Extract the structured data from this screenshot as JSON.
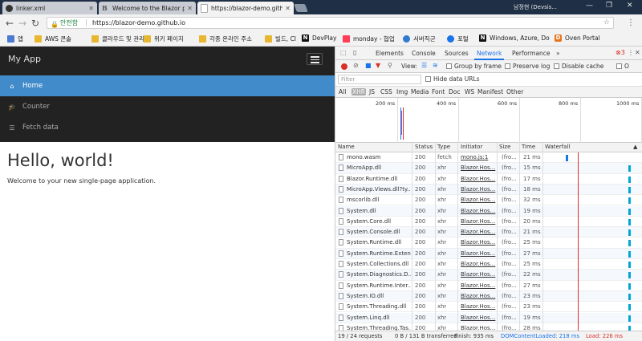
{
  "browser": {
    "tabs": [
      {
        "title": "linker.xml",
        "icon": "github-icon"
      },
      {
        "title": "Welcome to the Blazor p",
        "icon": "blazor-icon"
      },
      {
        "title": "https://blazor-demo.githu",
        "icon": "page-icon"
      }
    ],
    "user": "남정현 (Devsis...",
    "security_label": "안전함",
    "url": "https://blazor-demo.github.io",
    "bookmarks": [
      {
        "label": "앱",
        "icon": "apps-icon"
      },
      {
        "label": "AWS 콘솔",
        "icon": "folder-icon"
      },
      {
        "label": "클라우드 및 관리",
        "icon": "folder-icon"
      },
      {
        "label": "위키 페이지",
        "icon": "folder-icon"
      },
      {
        "label": "각종 온라인 주소",
        "icon": "folder-icon"
      },
      {
        "label": "빌드, CI",
        "icon": "folder-icon"
      },
      {
        "label": "DevPlay",
        "icon": "notion-icon"
      },
      {
        "label": "monday - 협업",
        "icon": "monday-icon"
      },
      {
        "label": "서버직군",
        "icon": "globe-icon"
      },
      {
        "label": "포털",
        "icon": "edge-icon"
      },
      {
        "label": "Windows, Azure, Do",
        "icon": "notion-icon"
      },
      {
        "label": "Oven Portal",
        "icon": "oven-icon"
      }
    ]
  },
  "app": {
    "title": "My App",
    "nav": [
      {
        "label": "Home",
        "icon": "home-icon",
        "active": true
      },
      {
        "label": "Counter",
        "icon": "graduation-cap-icon",
        "active": false
      },
      {
        "label": "Fetch data",
        "icon": "list-icon",
        "active": false
      }
    ],
    "heading": "Hello, world!",
    "subtitle": "Welcome to your new single-page application."
  },
  "devtools": {
    "tabs": [
      "Elements",
      "Console",
      "Sources",
      "Network",
      "Performance"
    ],
    "active_tab": "Network",
    "more_tabs": "»",
    "error_count": "3",
    "toolbar": {
      "view_label": "View:",
      "group_by_frame": "Group by frame",
      "preserve_log": "Preserve log",
      "disable_cache": "Disable cache",
      "offline": "O"
    },
    "filter_placeholder": "Filter",
    "hide_data_urls": "Hide data URLs",
    "types": [
      "All",
      "XHR",
      "JS",
      "CSS",
      "Img",
      "Media",
      "Font",
      "Doc",
      "WS",
      "Manifest",
      "Other"
    ],
    "active_type": "XHR",
    "timeline_ticks": [
      "200 ms",
      "400 ms",
      "600 ms",
      "800 ms",
      "1000 ms"
    ],
    "columns": [
      "Name",
      "Status",
      "Type",
      "Initiator",
      "Size",
      "Time",
      "Waterfall"
    ],
    "requests": [
      {
        "name": "mono.wasm",
        "status": "200",
        "type": "fetch",
        "initiator": "mono.js:1",
        "size": "(fro...",
        "time": "21 ms"
      },
      {
        "name": "MicroApp.dll",
        "status": "200",
        "type": "xhr",
        "initiator": "Blazor.Hos...",
        "size": "(fro...",
        "time": "15 ms"
      },
      {
        "name": "Blazor.Runtime.dll",
        "status": "200",
        "type": "xhr",
        "initiator": "Blazor.Hos...",
        "size": "(fro...",
        "time": "17 ms"
      },
      {
        "name": "MicroApp.Views.dll?ty...",
        "status": "200",
        "type": "xhr",
        "initiator": "Blazor.Hos...",
        "size": "(fro...",
        "time": "18 ms"
      },
      {
        "name": "mscorlib.dll",
        "status": "200",
        "type": "xhr",
        "initiator": "Blazor.Hos...",
        "size": "(fro...",
        "time": "32 ms"
      },
      {
        "name": "System.dll",
        "status": "200",
        "type": "xhr",
        "initiator": "Blazor.Hos...",
        "size": "(fro...",
        "time": "19 ms"
      },
      {
        "name": "System.Core.dll",
        "status": "200",
        "type": "xhr",
        "initiator": "Blazor.Hos...",
        "size": "(fro...",
        "time": "20 ms"
      },
      {
        "name": "System.Console.dll",
        "status": "200",
        "type": "xhr",
        "initiator": "Blazor.Hos...",
        "size": "(fro...",
        "time": "21 ms"
      },
      {
        "name": "System.Runtime.dll",
        "status": "200",
        "type": "xhr",
        "initiator": "Blazor.Hos...",
        "size": "(fro...",
        "time": "25 ms"
      },
      {
        "name": "System.Runtime.Exten...",
        "status": "200",
        "type": "xhr",
        "initiator": "Blazor.Hos...",
        "size": "(fro...",
        "time": "27 ms"
      },
      {
        "name": "System.Collections.dll",
        "status": "200",
        "type": "xhr",
        "initiator": "Blazor.Hos...",
        "size": "(fro...",
        "time": "25 ms"
      },
      {
        "name": "System.Diagnostics.D...",
        "status": "200",
        "type": "xhr",
        "initiator": "Blazor.Hos...",
        "size": "(fro...",
        "time": "22 ms"
      },
      {
        "name": "System.Runtime.Inter...",
        "status": "200",
        "type": "xhr",
        "initiator": "Blazor.Hos...",
        "size": "(fro...",
        "time": "27 ms"
      },
      {
        "name": "System.IO.dll",
        "status": "200",
        "type": "xhr",
        "initiator": "Blazor.Hos...",
        "size": "(fro...",
        "time": "23 ms"
      },
      {
        "name": "System.Threading.dll",
        "status": "200",
        "type": "xhr",
        "initiator": "Blazor.Hos...",
        "size": "(fro...",
        "time": "23 ms"
      },
      {
        "name": "System.Linq.dll",
        "status": "200",
        "type": "xhr",
        "initiator": "Blazor.Hos...",
        "size": "(fro...",
        "time": "19 ms"
      },
      {
        "name": "System.Threading.Tas...",
        "status": "200",
        "type": "xhr",
        "initiator": "Blazor.Hos...",
        "size": "(fro...",
        "time": "28 ms"
      }
    ],
    "status_bar": {
      "requests": "19 / 24 requests",
      "transferred": "0 B / 131 B transferred",
      "finish": "Finish: 935 ms",
      "dom_loaded": "DOMContentLoaded: 218 ms",
      "load": "Load: 226 ms"
    },
    "colors": {
      "dom_loaded": "#1a73e8",
      "load": "#d93025",
      "accent": "#1a73e8",
      "waterfall": "#00a6d6"
    }
  }
}
